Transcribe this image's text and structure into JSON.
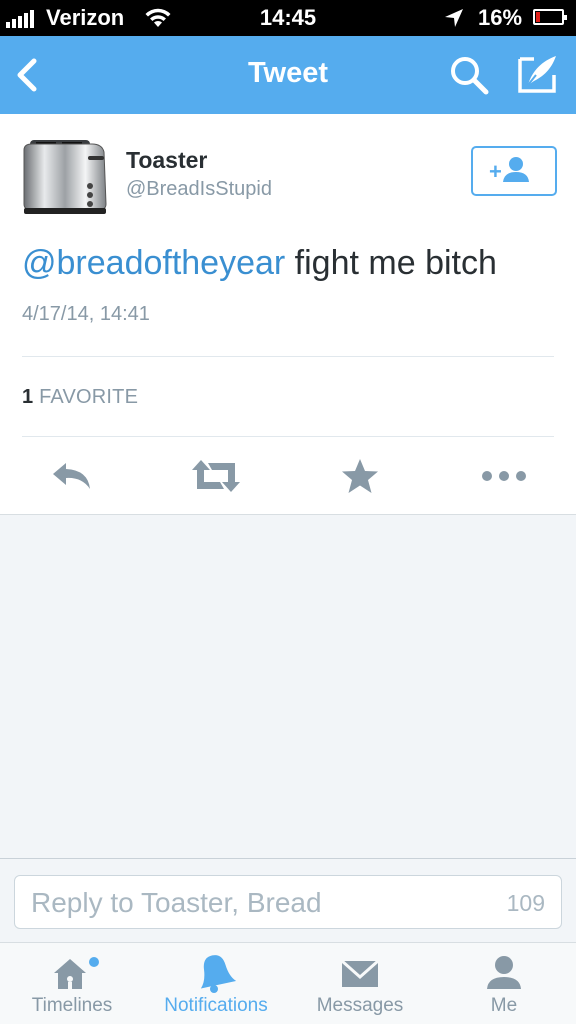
{
  "status_bar": {
    "carrier": "Verizon",
    "time": "14:45",
    "battery_percent": "16%",
    "signal_icon": "signal-bars-icon",
    "wifi_icon": "wifi-icon",
    "location_icon": "location-arrow-icon",
    "battery_icon": "battery-icon"
  },
  "nav": {
    "title": "Tweet",
    "back_icon": "chevron-left-icon",
    "search_icon": "search-icon",
    "compose_icon": "compose-quill-icon",
    "color": "#55acee"
  },
  "tweet": {
    "user_name": "Toaster",
    "user_handle": "@BreadIsStupid",
    "avatar_icon": "toaster-avatar",
    "follow_icon": "follow-user-icon",
    "mention": "@breadoftheyear",
    "text": " fight me bitch",
    "timestamp": "4/17/14, 14:41",
    "favorite_count": "1",
    "favorite_label": "FAVORITE",
    "actions": [
      {
        "name": "reply",
        "icon": "reply-icon"
      },
      {
        "name": "retweet",
        "icon": "retweet-icon"
      },
      {
        "name": "favorite",
        "icon": "star-icon"
      },
      {
        "name": "more",
        "icon": "more-dots-icon"
      }
    ],
    "mention_color": "#3a8fd1"
  },
  "reply": {
    "placeholder": "Reply to Toaster, Bread",
    "char_count": "109"
  },
  "tabs": [
    {
      "label": "Timelines",
      "icon": "home-icon",
      "active": false
    },
    {
      "label": "Notifications",
      "icon": "bell-icon",
      "active": true
    },
    {
      "label": "Messages",
      "icon": "envelope-icon",
      "active": false
    },
    {
      "label": "Me",
      "icon": "person-icon",
      "active": false
    }
  ]
}
